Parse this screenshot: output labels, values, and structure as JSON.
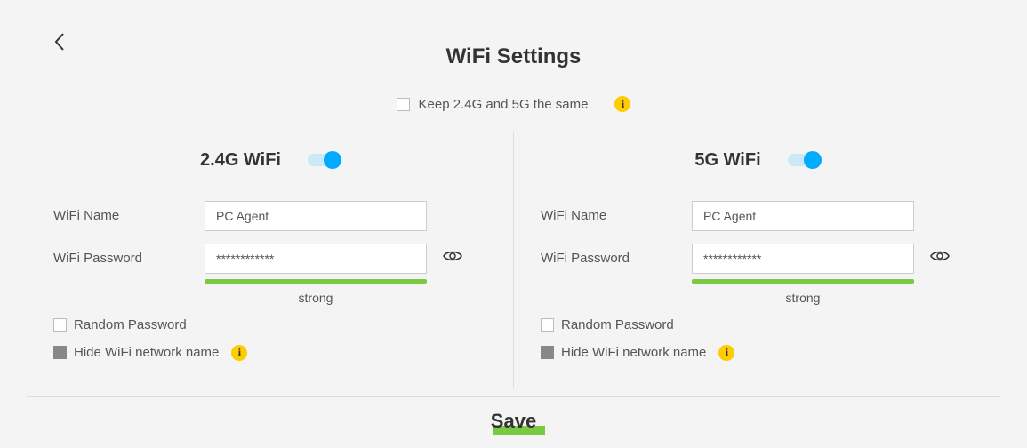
{
  "page": {
    "title": "WiFi Settings",
    "keep_same_label": "Keep 2.4G and 5G the same",
    "save_label": "Save"
  },
  "wifi24": {
    "title": "2.4G WiFi",
    "name_label": "WiFi Name",
    "name_value": "PC Agent",
    "password_label": "WiFi Password",
    "password_value": "************",
    "strength_label": "strong",
    "random_label": "Random Password",
    "hide_label": "Hide WiFi network name"
  },
  "wifi5": {
    "title": "5G WiFi",
    "name_label": "WiFi Name",
    "name_value": "PC Agent",
    "password_label": "WiFi Password",
    "password_value": "************",
    "strength_label": "strong",
    "random_label": "Random Password",
    "hide_label": "Hide WiFi network name"
  }
}
